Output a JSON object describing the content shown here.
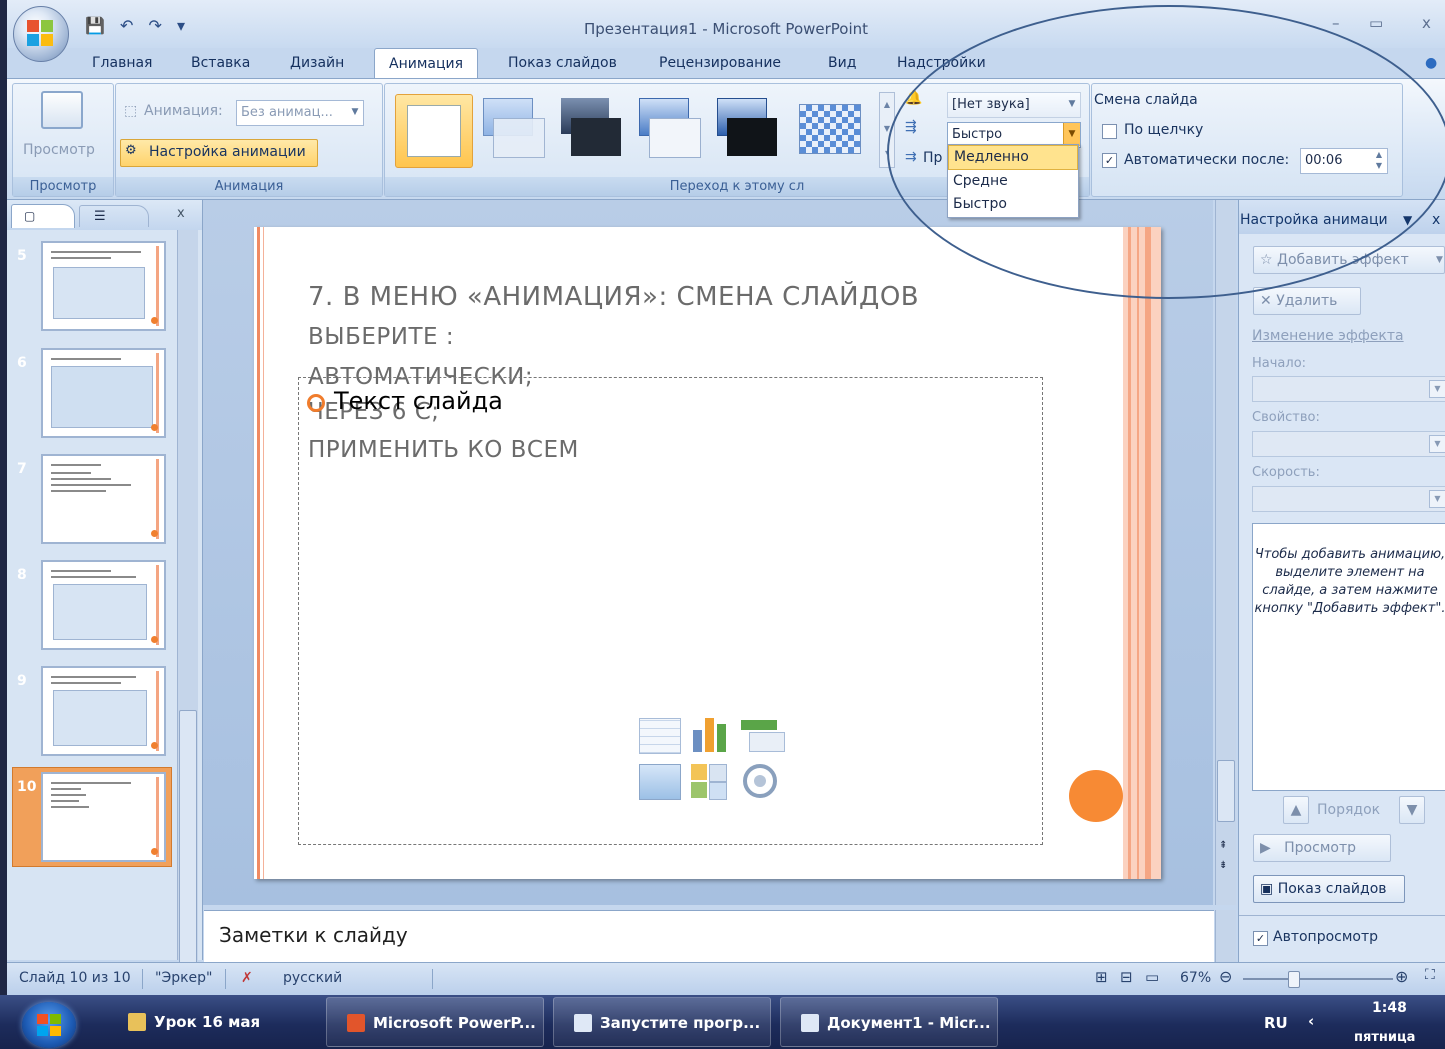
{
  "window": {
    "title": "Презентация1 - Microsoft PowerPoint",
    "min": "–",
    "restore": "▭",
    "close": "x"
  },
  "tabs": [
    "Главная",
    "Вставка",
    "Дизайн",
    "Анимация",
    "Показ слайдов",
    "Рецензирование",
    "Вид",
    "Надстройки"
  ],
  "ribbon": {
    "preview_label": "Просмотр",
    "preview_group": "Просмотр",
    "animation_label": "Анимация:",
    "animation_value": "Без анимац...",
    "custom_animation": "Настройка анимации",
    "animation_group": "Анимация",
    "sound_value": "[Нет звука]",
    "speed_value": "Быстро",
    "apply_all_short": "Пр",
    "transition_group": "Переход к этому сл",
    "slide_change": "Смена слайда",
    "on_click": "По щелчку",
    "auto_after": "Автоматически после:",
    "auto_time": "00:06",
    "speed_options": [
      "Медленно",
      "Средне",
      "Быстро"
    ]
  },
  "slides": {
    "numbers": [
      "5",
      "6",
      "7",
      "8",
      "9",
      "10"
    ],
    "selected": "10"
  },
  "slide": {
    "title_lines": [
      "7. В  МЕНЮ «АНИМАЦИЯ»: СМЕНА СЛАЙДОВ",
      "ВЫБЕРИТЕ :",
      "АВТОМАТИЧЕСКИ;",
      "ЧЕРЕЗ 6 С;",
      "ПРИМЕНИТЬ КО ВСЕМ"
    ],
    "placeholder_text": "Текст слайда"
  },
  "notes": "Заметки к слайду",
  "taskpane": {
    "title": "Настройка анимаци",
    "add_effect": "Добавить эффект",
    "remove": "Удалить",
    "change_effect": "Изменение эффекта",
    "start_label": "Начало:",
    "property_label": "Свойство:",
    "speed_label": "Скорость:",
    "info": "Чтобы добавить анимацию, выделите элемент на слайде, а затем нажмите кнопку \"Добавить эффект\".",
    "order": "Порядок",
    "preview": "Просмотр",
    "slideshow": "Показ слайдов",
    "autopreview": "Автопросмотр"
  },
  "status": {
    "slide": "Слайд 10 из 10",
    "theme": "\"Эркер\"",
    "language": "русский",
    "zoom": "67%"
  },
  "taskbar": {
    "items": [
      "Урок 16 мая",
      "Microsoft PowerP...",
      "Запустите прогр...",
      "Документ1 - Micr..."
    ],
    "lang": "RU",
    "time": "1:48",
    "day": "пятница"
  },
  "colors": {
    "accent": "#f78a34",
    "ribbon": "#d3e2f4",
    "taskbar": "#1d2c5c"
  }
}
